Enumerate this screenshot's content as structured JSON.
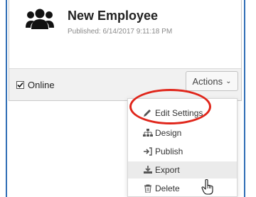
{
  "card": {
    "title": "New Employee",
    "published": "Published: 6/14/2017 9:11:18 PM",
    "online_label": "Online",
    "online_checked": true,
    "actions_label": "Actions"
  },
  "menu": {
    "items": [
      {
        "label": "Edit Settings",
        "icon": "pencil-icon"
      },
      {
        "label": "Design",
        "icon": "hierarchy-icon"
      },
      {
        "label": "Publish",
        "icon": "sign-in-icon"
      },
      {
        "label": "Export",
        "icon": "download-icon"
      },
      {
        "label": "Delete",
        "icon": "trash-icon"
      }
    ]
  },
  "icons": {
    "card": "users-icon",
    "chevron": "chevron-down-icon",
    "cursor": "hand-pointer-icon"
  },
  "colors": {
    "highlight_ring": "#e0261b",
    "frame_border": "#2f6db5",
    "menu_hover": "#ebebeb"
  }
}
